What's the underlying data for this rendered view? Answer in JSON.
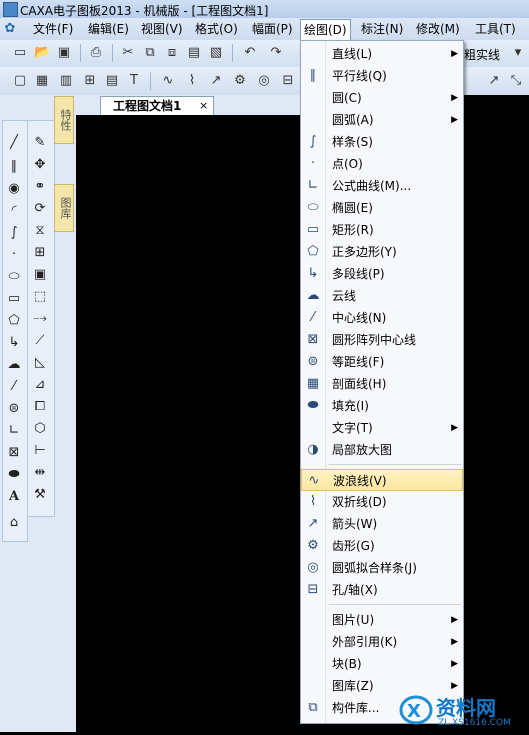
{
  "window": {
    "title": "CAXA电子图板2013 - 机械版 - [工程图文档1]"
  },
  "menubar": {
    "items": [
      "文件(F)",
      "编辑(E)",
      "视图(V)",
      "格式(O)",
      "幅面(P)",
      "绘图(D)",
      "标注(N)",
      "修改(M)",
      "工具(T)"
    ],
    "active": "绘图(D)"
  },
  "toolbar": {
    "linestyle_label": "粗实线"
  },
  "panel_tabs": [
    "特性",
    "图库"
  ],
  "document": {
    "tab_title": "工程图文档1",
    "close_glyph": "×"
  },
  "draw_menu": {
    "items": [
      {
        "label": "直线(L)",
        "icon": "line-icon",
        "submenu": true
      },
      {
        "label": "平行线(Q)",
        "icon": "parallel-lines-icon",
        "submenu": false
      },
      {
        "label": "圆(C)",
        "icon": "circle-icon",
        "submenu": true
      },
      {
        "label": "圆弧(A)",
        "icon": "arc-icon",
        "submenu": true
      },
      {
        "label": "样条(S)",
        "icon": "spline-icon",
        "submenu": false
      },
      {
        "label": "点(O)",
        "icon": "point-icon",
        "submenu": false
      },
      {
        "label": "公式曲线(M)...",
        "icon": "formula-curve-icon",
        "submenu": false
      },
      {
        "label": "椭圆(E)",
        "icon": "ellipse-icon",
        "submenu": false
      },
      {
        "label": "矩形(R)",
        "icon": "rectangle-icon",
        "submenu": false
      },
      {
        "label": "正多边形(Y)",
        "icon": "polygon-icon",
        "submenu": false
      },
      {
        "label": "多段线(P)",
        "icon": "polyline-icon",
        "submenu": false
      },
      {
        "label": "云线",
        "icon": "cloud-icon",
        "submenu": false
      },
      {
        "label": "中心线(N)",
        "icon": "centerline-icon",
        "submenu": false
      },
      {
        "label": "圆形阵列中心线",
        "icon": "circular-array-centerline-icon",
        "submenu": false
      },
      {
        "label": "等距线(F)",
        "icon": "offset-line-icon",
        "submenu": false
      },
      {
        "label": "剖面线(H)",
        "icon": "hatch-icon",
        "submenu": false
      },
      {
        "label": "填充(I)",
        "icon": "fill-icon",
        "submenu": false
      },
      {
        "label": "文字(T)",
        "icon": "",
        "submenu": true
      },
      {
        "label": "局部放大图",
        "icon": "detail-view-icon",
        "submenu": false
      },
      {
        "label": "波浪线(V)",
        "icon": "wave-line-icon",
        "submenu": false,
        "highlighted": true
      },
      {
        "label": "双折线(D)",
        "icon": "break-line-icon",
        "submenu": false
      },
      {
        "label": "箭头(W)",
        "icon": "arrow-icon",
        "submenu": false
      },
      {
        "label": "齿形(G)",
        "icon": "gear-tooth-icon",
        "submenu": false
      },
      {
        "label": "圆弧拟合样条(J)",
        "icon": "arc-fit-spline-icon",
        "submenu": false
      },
      {
        "label": "孔/轴(X)",
        "icon": "hole-shaft-icon",
        "submenu": false
      },
      {
        "label": "图片(U)",
        "icon": "",
        "submenu": true
      },
      {
        "label": "外部引用(K)",
        "icon": "",
        "submenu": true
      },
      {
        "label": "块(B)",
        "icon": "",
        "submenu": true
      },
      {
        "label": "图库(Z)",
        "icon": "",
        "submenu": true
      },
      {
        "label": "构件库...",
        "icon": "component-library-icon",
        "submenu": false
      }
    ]
  },
  "watermark": {
    "brand": "资料网",
    "url": "ZL.XS1616.COM"
  }
}
